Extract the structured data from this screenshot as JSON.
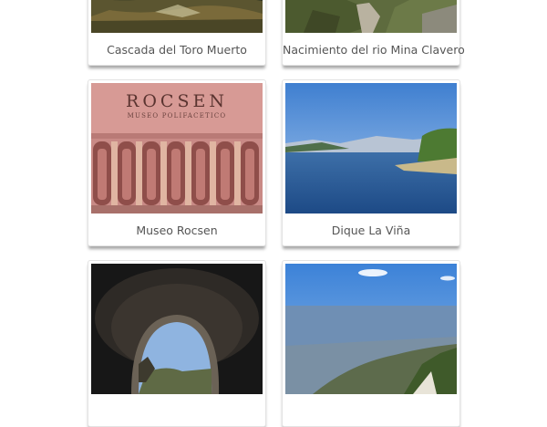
{
  "gallery": {
    "items": [
      {
        "caption": "Cascada del Toro Muerto"
      },
      {
        "caption": "Nacimiento del rio Mina Clavero"
      },
      {
        "caption": "Museo Rocsen",
        "sign_title": "ROCSEN",
        "sign_subtitle": "MUSEO POLIFACETICO"
      },
      {
        "caption": "Dique La Viña"
      },
      {
        "caption": ""
      },
      {
        "caption": ""
      }
    ]
  }
}
